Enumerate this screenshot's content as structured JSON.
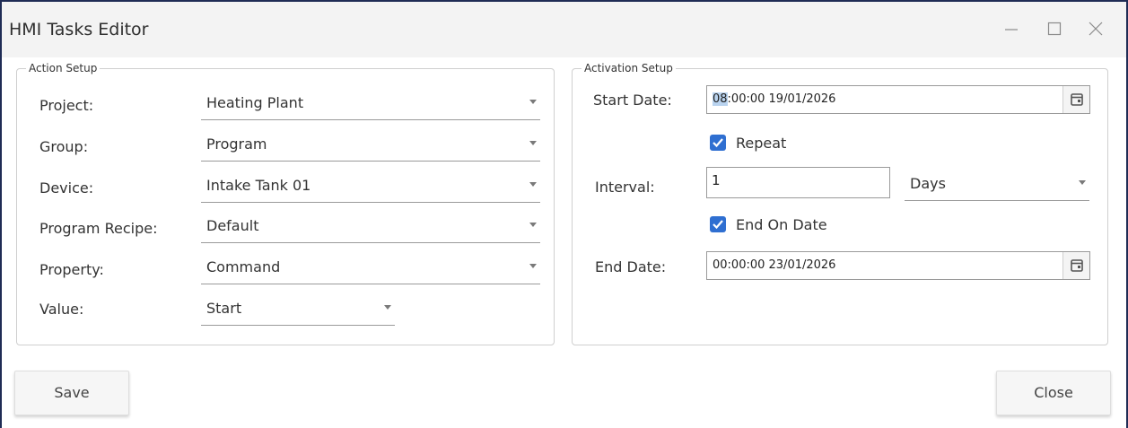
{
  "window": {
    "title": "HMI Tasks Editor",
    "controls": [
      "minimize-icon",
      "maximize-icon",
      "close-icon"
    ]
  },
  "action_setup": {
    "legend": "Action Setup",
    "fields": [
      {
        "label": "Project:",
        "value": "Heating Plant"
      },
      {
        "label": "Group:",
        "value": "Program"
      },
      {
        "label": "Device:",
        "value": "Intake Tank 01"
      },
      {
        "label": "Program Recipe:",
        "value": "Default"
      },
      {
        "label": "Property:",
        "value": "Command"
      },
      {
        "label": "Value:",
        "value": "Start"
      }
    ]
  },
  "activation_setup": {
    "legend": "Activation Setup",
    "start_date": {
      "label": "Start Date:",
      "value_selected": "08",
      "value_rest": ":00:00 19/01/2026"
    },
    "repeat": {
      "label": "Repeat",
      "checked": true
    },
    "interval": {
      "label": "Interval:",
      "value": "1",
      "unit": "Days"
    },
    "end_on_date": {
      "label": "End On Date",
      "checked": true
    },
    "end_date": {
      "label": "End Date:",
      "value": "00:00:00 23/01/2026"
    }
  },
  "buttons": {
    "save": "Save",
    "close": "Close"
  },
  "colors": {
    "window_border": "#1f2c55",
    "titlebar": "#f3f3f3",
    "checkbox": "#2f6fd1",
    "selection": "#b9d3ef"
  }
}
